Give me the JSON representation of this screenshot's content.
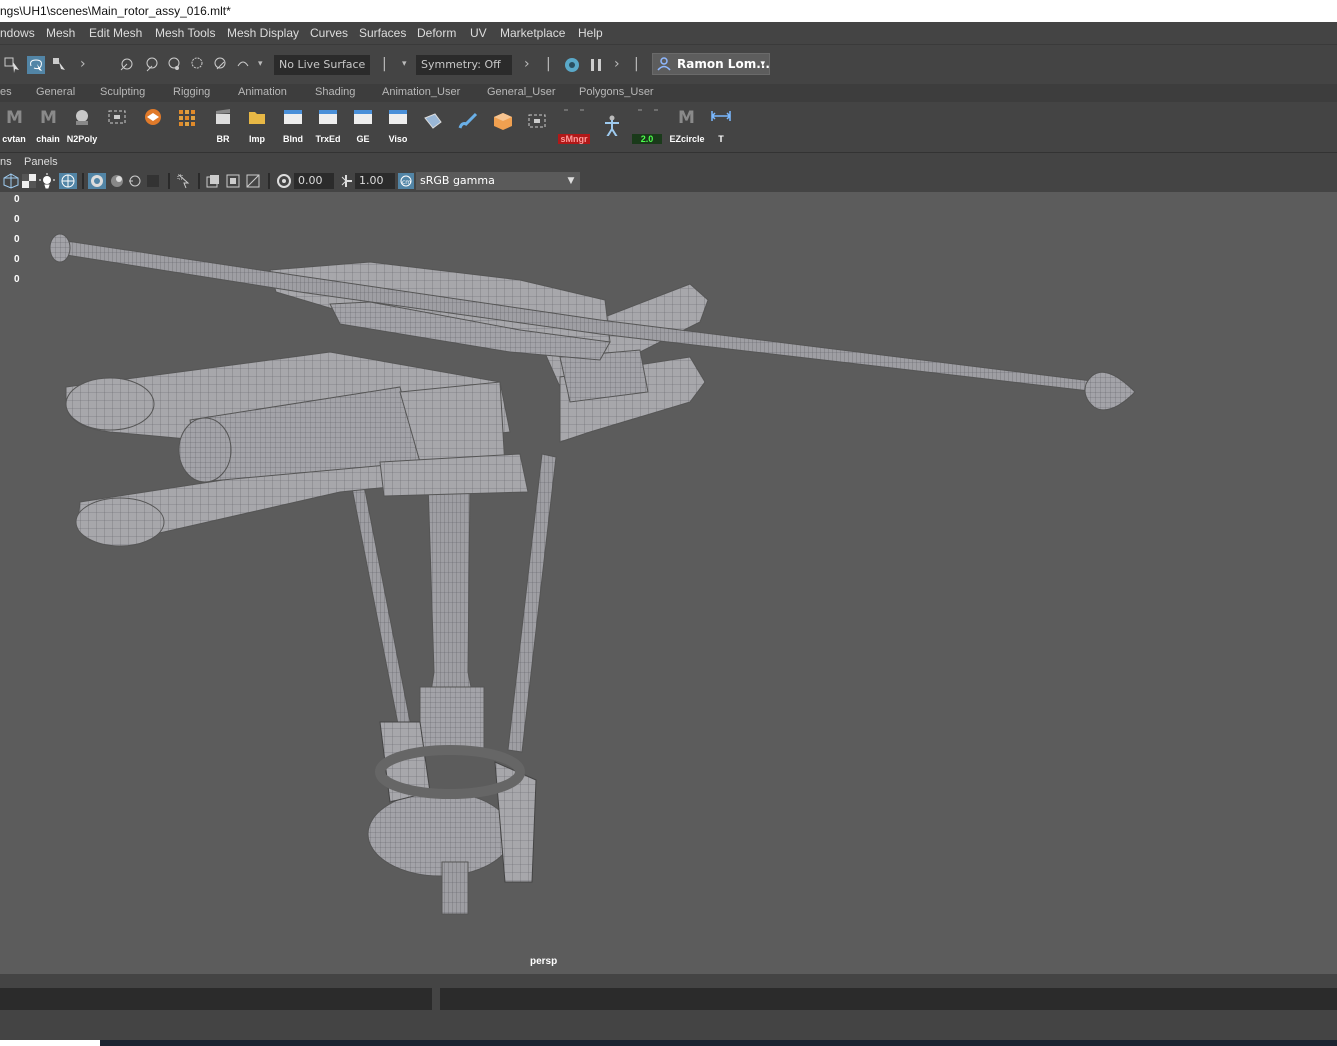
{
  "window": {
    "title": "ngs\\UH1\\scenes\\Main_rotor_assy_016.mlt*"
  },
  "menu": [
    "ndows",
    "Mesh",
    "Edit Mesh",
    "Mesh Tools",
    "Mesh Display",
    "Curves",
    "Surfaces",
    "Deform",
    "UV",
    "Marketplace",
    "Help"
  ],
  "statusline": {
    "live_surface": "No Live Surface",
    "symmetry": "Symmetry: Off",
    "user": "Ramon Lom..."
  },
  "shelf_tabs": [
    "es",
    "General",
    "Sculpting",
    "Rigging",
    "Animation",
    "Shading",
    "Animation_User",
    "General_User",
    "Polygons_User"
  ],
  "shelf_buttons": [
    {
      "label": "cvtan",
      "icon": "maya-m-icon"
    },
    {
      "label": "chain",
      "icon": "maya-m-icon"
    },
    {
      "label": "N2Poly",
      "icon": "sphere-icon"
    },
    {
      "label": "",
      "icon": "select-box-icon"
    },
    {
      "label": "",
      "icon": "layers-icon"
    },
    {
      "label": "",
      "icon": "grid-icon"
    },
    {
      "label": "BR",
      "icon": "clapper-icon"
    },
    {
      "label": "Imp",
      "icon": "folder-icon"
    },
    {
      "label": "Blnd",
      "icon": "window-icon"
    },
    {
      "label": "TrxEd",
      "icon": "window-icon"
    },
    {
      "label": "GE",
      "icon": "window-icon"
    },
    {
      "label": "Viso",
      "icon": "window-icon"
    },
    {
      "label": "",
      "icon": "tag-icon"
    },
    {
      "label": "",
      "icon": "brush-icon"
    },
    {
      "label": "",
      "icon": "box-icon"
    },
    {
      "label": "",
      "icon": "select-box-icon"
    },
    {
      "label": "sMngr",
      "icon": "manager-icon"
    },
    {
      "label": "",
      "icon": "skeleton-icon"
    },
    {
      "label": "2.0",
      "icon": "counter-icon"
    },
    {
      "label": "EZcircle",
      "icon": "maya-m-icon"
    },
    {
      "label": "T",
      "icon": "measure-icon"
    }
  ],
  "panel_menu": [
    "ns",
    "Panels"
  ],
  "panel_toolbar": {
    "exposure": "0.00",
    "gamma": "1.00",
    "color_space": "sRGB gamma"
  },
  "hud": [
    "0",
    "0",
    "0",
    "0",
    "0"
  ],
  "camera_label": "persp"
}
